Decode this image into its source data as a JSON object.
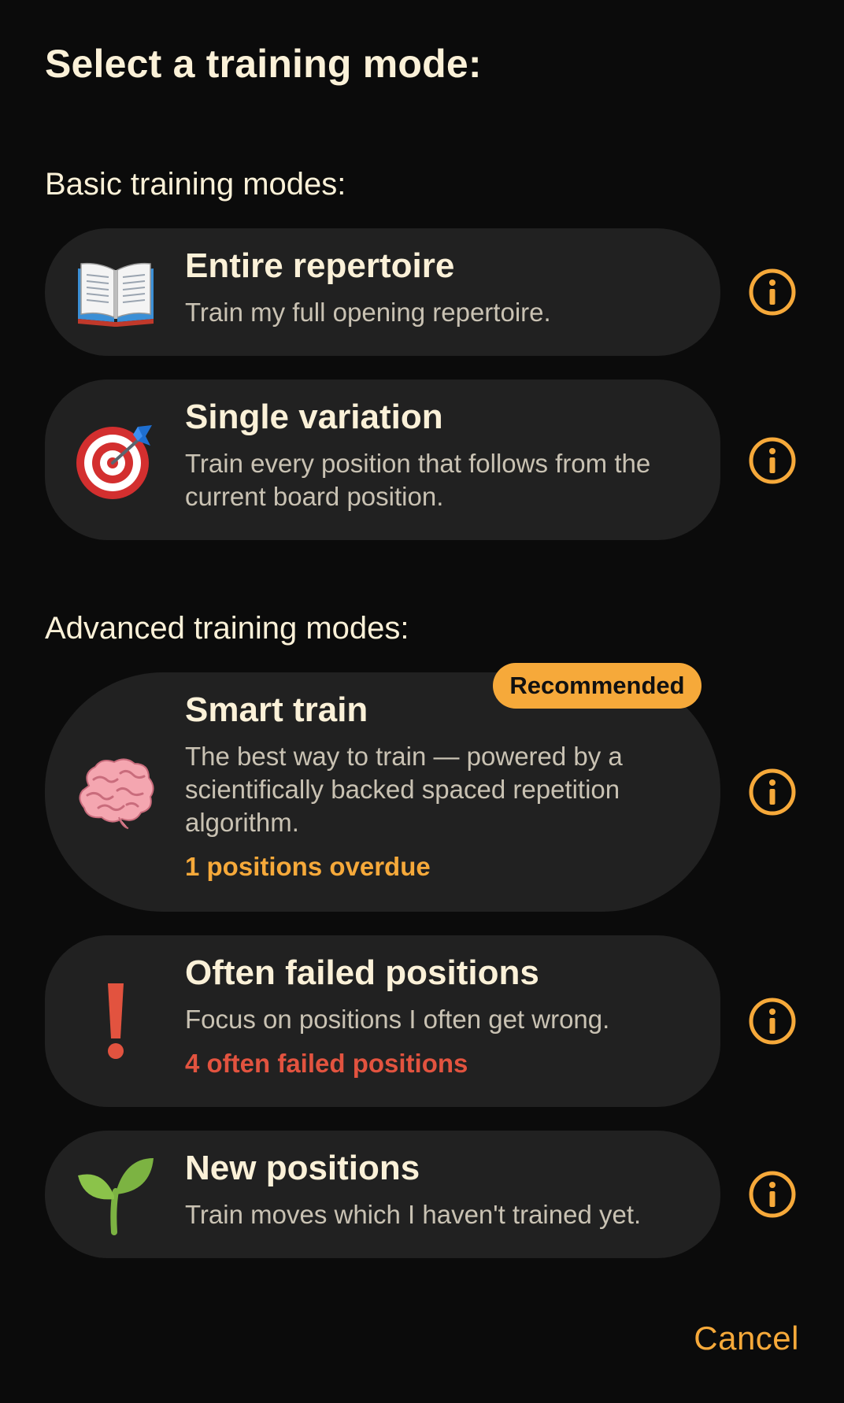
{
  "dialog": {
    "title": "Select a training mode:",
    "cancel_label": "Cancel"
  },
  "sections": {
    "basic_heading": "Basic training modes:",
    "advanced_heading": "Advanced training modes:"
  },
  "modes": {
    "entire": {
      "icon": "open-book-icon",
      "title": "Entire repertoire",
      "description": "Train my full opening repertoire."
    },
    "single": {
      "icon": "target-dart-icon",
      "title": "Single variation",
      "description": "Train every position that follows from the current board position."
    },
    "smart": {
      "icon": "brain-icon",
      "badge": "Recommended",
      "title": "Smart train",
      "description": "The best way to train — powered by a scientifically backed spaced repetition algorithm.",
      "stat": "1 positions overdue"
    },
    "failed": {
      "icon": "exclamation-icon",
      "title": "Often failed positions",
      "description": "Focus on positions I often get wrong.",
      "stat": "4 often failed positions"
    },
    "new": {
      "icon": "seedling-icon",
      "title": "New positions",
      "description": "Train moves which I haven't trained yet."
    }
  },
  "colors": {
    "background": "#0b0b0b",
    "card": "#212121",
    "accent": "#f6a93a",
    "danger": "#e2533f",
    "text": "#fbf1d8",
    "muted": "#c9c2b3"
  }
}
